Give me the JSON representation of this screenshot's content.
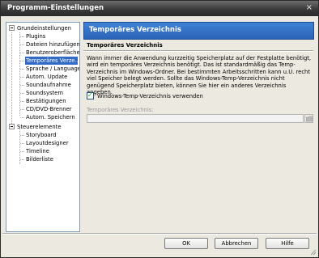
{
  "window": {
    "title": "Programm-Einstellungen",
    "close_glyph": "×"
  },
  "tree": {
    "items": [
      {
        "label": "Grundeinstellungen"
      },
      {
        "label": "Plugins"
      },
      {
        "label": "Dateien hinzufügen"
      },
      {
        "label": "Benutzeroberfläche"
      },
      {
        "label": "Temporäres Verze..."
      },
      {
        "label": "Sprache / Language"
      },
      {
        "label": "Autom. Update"
      },
      {
        "label": "Soundaufnahme"
      },
      {
        "label": "Soundsystem"
      },
      {
        "label": "Bestätigungen"
      },
      {
        "label": "CD/DVD-Brenner"
      },
      {
        "label": "Autom. Speichern"
      },
      {
        "label": "Steuerelemente"
      },
      {
        "label": "Storyboard"
      },
      {
        "label": "Layoutdesigner"
      },
      {
        "label": "Timeline"
      },
      {
        "label": "Bilderliste"
      }
    ]
  },
  "panel": {
    "header": "Temporäres Verzeichnis",
    "section_title": "Temporäres Verzeichnis",
    "description": "Wann immer die Anwendung kurzzeitig Speicherplatz auf der Festplatte benötigt, wird ein temporäres Verzeichnis benötigt. Das ist standardmäßig das Temp-Verzeichnis im Windows-Ordner. Bei bestimmten Arbeitsschritten kann u.U. recht viel Speicher belegt werden. Sollte das Windows-Temp-Verzeichnis nicht genügend Speicherplatz bieten, können Sie hier ein anderes Verzeichnis angeben.",
    "checkbox_label": "Windows-Temp-Verzeichnis verwenden",
    "checkbox_checked": true,
    "field_label": "Temporäres Verzeichnis:",
    "field_value": ""
  },
  "buttons": {
    "ok": "OK",
    "cancel": "Abbrechen",
    "help": "Hilfe"
  },
  "colors": {
    "accent": "#316ac5",
    "header": "#2a63b8",
    "titlebar": "#3a3a3a"
  }
}
